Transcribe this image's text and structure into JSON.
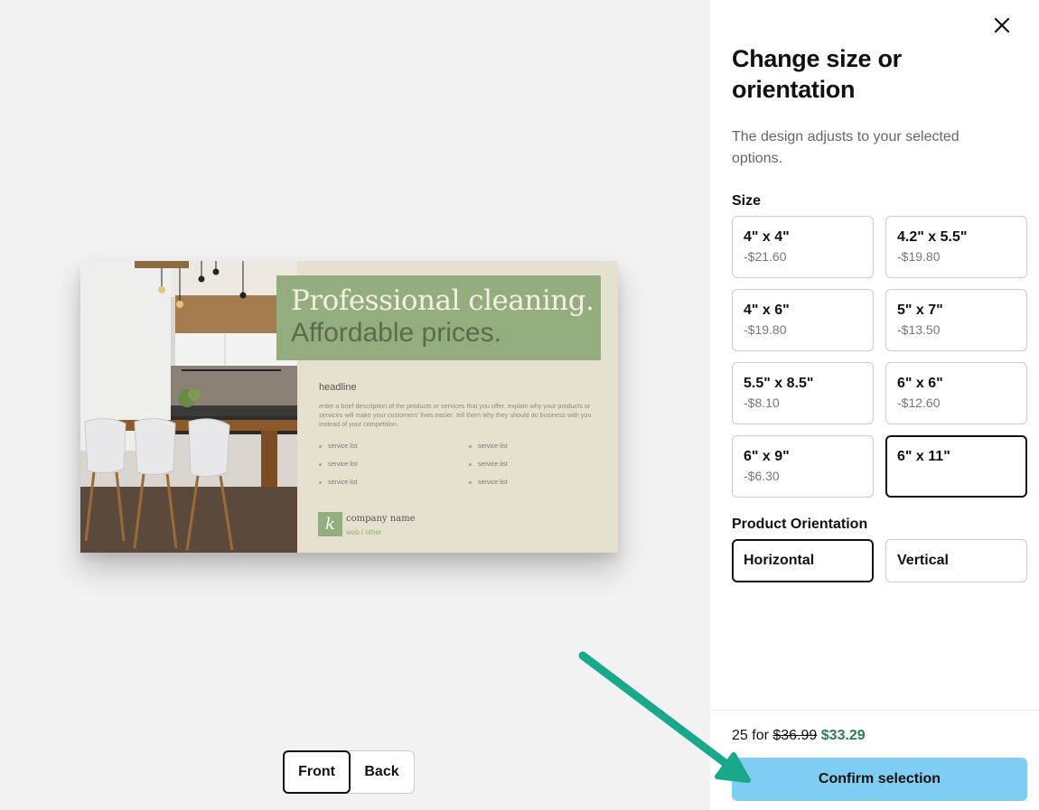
{
  "preview": {
    "card": {
      "banner_line1": "Professional cleaning.",
      "banner_line2": "Affordable prices.",
      "headline": "headline",
      "description": "enter a brief description of the products or services that you offer. explain why your products or services will make your customers' lives easier. tell them why they should do business with you instead of your competition.",
      "service_items_left": [
        "service list",
        "service list",
        "service list"
      ],
      "service_items_right": [
        "service list",
        "service list",
        "service list"
      ],
      "logo_letter": "k",
      "company_name": "company name",
      "web_text": "web / other"
    },
    "side_toggle": {
      "front_label": "Front",
      "back_label": "Back",
      "active": "Front"
    }
  },
  "panel": {
    "title": "Change size or orientation",
    "subtitle": "The design adjusts to your selected options.",
    "size_label": "Size",
    "sizes": [
      {
        "name": "4\" x 4\"",
        "price": "-$21.60"
      },
      {
        "name": "4.2\" x 5.5\"",
        "price": "-$19.80"
      },
      {
        "name": "4\" x 6\"",
        "price": "-$19.80"
      },
      {
        "name": "5\" x 7\"",
        "price": "-$13.50"
      },
      {
        "name": "5.5\" x 8.5\"",
        "price": "-$8.10"
      },
      {
        "name": "6\" x 6\"",
        "price": "-$12.60"
      },
      {
        "name": "6\" x 9\"",
        "price": "-$6.30"
      },
      {
        "name": "6\" x 11\"",
        "price": ""
      }
    ],
    "selected_size": "6\" x 11\"",
    "orientation_label": "Product Orientation",
    "orientations": [
      "Horizontal",
      "Vertical"
    ],
    "selected_orientation": "Horizontal",
    "price": {
      "quantity_text": "25 for",
      "old_price": "$36.99",
      "new_price": "$33.29"
    },
    "confirm_label": "Confirm selection"
  },
  "colors": {
    "accent_button": "#7fcdf2",
    "new_price": "#2f7d4d",
    "banner_green": "#94ad7e",
    "card_bg": "#e6e1cf",
    "annotation_arrow": "#1aa88a"
  },
  "icons": {
    "close": "close-icon",
    "arrow": "annotation-arrow"
  }
}
